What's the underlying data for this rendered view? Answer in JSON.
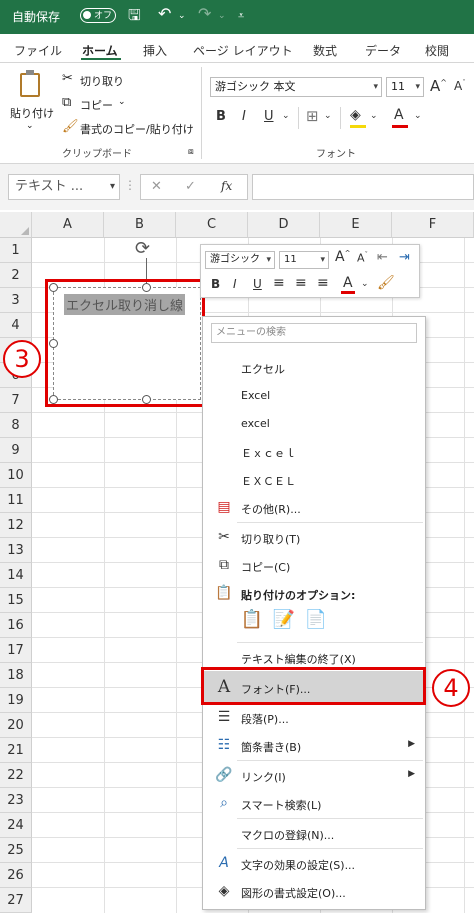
{
  "titlebar": {
    "autosave_label": "自動保存",
    "autosave_state": "オフ",
    "save_icon": "save-icon",
    "undo_icon": "undo-icon",
    "redo_icon": "redo-icon"
  },
  "tabs": [
    "ファイル",
    "ホーム",
    "挿入",
    "ページ レイアウト",
    "数式",
    "データ",
    "校閲"
  ],
  "ribbon": {
    "paste_label": "貼り付け",
    "cut_label": "切り取り",
    "copy_label": "コピー",
    "format_painter_label": "書式のコピー/貼り付け",
    "clipboard_group": "クリップボード",
    "font_name": "游ゴシック 本文",
    "font_size": "11",
    "font_group": "フォント",
    "bold": "B",
    "italic": "I",
    "underline": "U",
    "grow": "A",
    "shrink": "A",
    "font_color_letter": "A"
  },
  "formula_bar": {
    "name_box": "テキスト ...",
    "cancel": "✕",
    "enter": "✓",
    "fx": "fx"
  },
  "grid": {
    "columns": [
      "A",
      "B",
      "C",
      "D",
      "E",
      "F"
    ],
    "rows": [
      "1",
      "2",
      "3",
      "4",
      "5",
      "6",
      "7",
      "8",
      "9",
      "10",
      "11",
      "12",
      "13",
      "14",
      "15",
      "16",
      "17",
      "18",
      "19",
      "20",
      "21",
      "22",
      "23",
      "24",
      "25",
      "26",
      "27"
    ]
  },
  "textbox": {
    "text": "エクセル取り消し線"
  },
  "callouts": {
    "step3": "3",
    "step4": "4"
  },
  "mini_toolbar": {
    "font_name": "游ゴシック",
    "font_size": "11",
    "bold": "B",
    "italic": "I",
    "underline": "U",
    "grow": "A",
    "shrink": "A",
    "font_color_letter": "A"
  },
  "context_menu": {
    "search_placeholder": "メニューの検索",
    "suggestions": [
      "エクセル",
      "Excel",
      "excel",
      "Ｅｘｃｅｌ",
      "ＥＸＣＥＬ"
    ],
    "other": "その他(R)...",
    "cut": "切り取り(T)",
    "copy": "コピー(C)",
    "paste_options": "貼り付けのオプション:",
    "end_text_edit": "テキスト編集の終了(X)",
    "font": "フォント(F)...",
    "paragraph": "段落(P)...",
    "bullets": "箇条書き(B)",
    "link": "リンク(I)",
    "smart_lookup": "スマート検索(L)",
    "record_macro": "マクロの登録(N)...",
    "text_effects": "文字の効果の設定(S)...",
    "shape_format": "図形の書式設定(O)..."
  },
  "colors": {
    "excel_green": "#217346",
    "highlight_red": "#e00000",
    "menu_highlight": "#d4d4d4"
  }
}
